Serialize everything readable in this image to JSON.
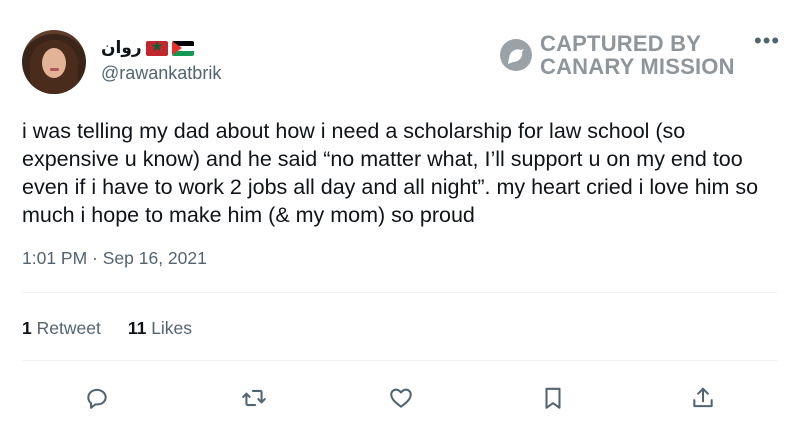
{
  "tweet": {
    "display_name": "روان",
    "handle": "@rawankatbrik",
    "text": "i was telling my dad about how i need a scholarship for law school (so expensive u know) and he said “no matter what, I’ll support u on my end too even if i have to work 2 jobs all day and all night”. my heart cried i love him so much i hope to make him (& my mom) so proud",
    "timestamp": "1:01 PM · Sep 16, 2021",
    "stats": {
      "retweets_count": "1",
      "retweets_label": "Retweet",
      "likes_count": "11",
      "likes_label": "Likes"
    }
  },
  "watermark": {
    "line1": "CAPTURED BY",
    "line2": "CANARY MISSION"
  },
  "icons": {
    "flags": [
      "morocco-flag-icon",
      "palestine-flag-icon"
    ],
    "actions": [
      "reply-icon",
      "retweet-icon",
      "like-icon",
      "bookmark-icon",
      "share-icon"
    ]
  },
  "colors": {
    "text": "#0f1419",
    "secondary": "#536471",
    "watermark": "#8e969c"
  }
}
